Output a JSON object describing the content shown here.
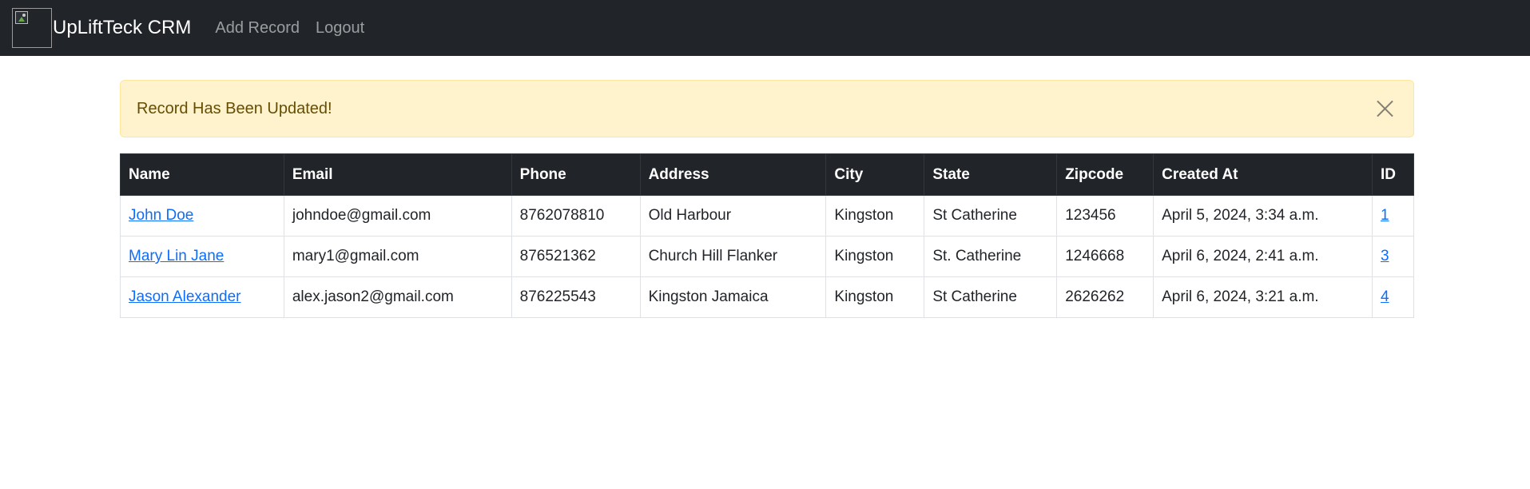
{
  "navbar": {
    "brand": "UpLiftTeck CRM",
    "links": [
      "Add Record",
      "Logout"
    ]
  },
  "alert": {
    "message": "Record Has Been Updated!"
  },
  "table": {
    "headers": [
      "Name",
      "Email",
      "Phone",
      "Address",
      "City",
      "State",
      "Zipcode",
      "Created At",
      "ID"
    ],
    "rows": [
      [
        "John Doe",
        "johndoe@gmail.com",
        "8762078810",
        "Old Harbour",
        "Kingston",
        "St Catherine",
        "123456",
        "April 5, 2024, 3:34 a.m.",
        "1"
      ],
      [
        "Mary Lin Jane",
        "mary1@gmail.com",
        "876521362",
        "Church Hill Flanker",
        "Kingston",
        "St. Catherine",
        "1246668",
        "April 6, 2024, 2:41 a.m.",
        "3"
      ],
      [
        "Jason Alexander",
        "alex.jason2@gmail.com",
        "876225543",
        "Kingston Jamaica",
        "Kingston",
        "St Catherine",
        "2626262",
        "April 6, 2024, 3:21 a.m.",
        "4"
      ]
    ]
  },
  "colors": {
    "navbar_bg": "#212529",
    "alert_bg": "#fff3cd",
    "link": "#0d6efd"
  }
}
